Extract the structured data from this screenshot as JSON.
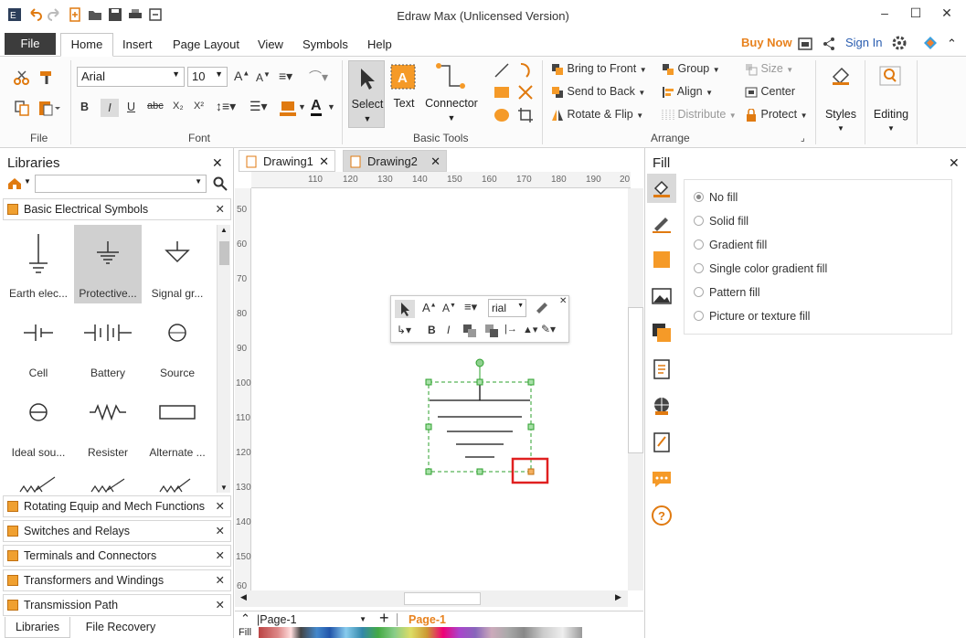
{
  "window": {
    "title": "Edraw Max (Unlicensed Version)"
  },
  "menu": {
    "file": "File",
    "items": [
      "Home",
      "Insert",
      "Page Layout",
      "View",
      "Symbols",
      "Help"
    ],
    "buy_now": "Buy Now",
    "sign_in": "Sign In"
  },
  "ribbon": {
    "file_group": "File",
    "font_group": "Font",
    "font_name": "Arial",
    "font_size": "10",
    "basic_tools_group": "Basic Tools",
    "select": "Select",
    "text": "Text",
    "connector": "Connector",
    "arrange_group": "Arrange",
    "bring_to_front": "Bring to Front",
    "send_to_back": "Send to Back",
    "rotate_flip": "Rotate & Flip",
    "group": "Group",
    "align": "Align",
    "distribute": "Distribute",
    "size": "Size",
    "center": "Center",
    "protect": "Protect",
    "styles": "Styles",
    "editing": "Editing"
  },
  "libraries": {
    "title": "Libraries",
    "active_section": "Basic Electrical Symbols",
    "shapes": [
      {
        "label": "Earth elec...",
        "icon": "earth-ground-icon"
      },
      {
        "label": "Protective...",
        "icon": "protective-ground-icon"
      },
      {
        "label": "Signal gr...",
        "icon": "signal-ground-icon"
      },
      {
        "label": "Cell",
        "icon": "cell-icon"
      },
      {
        "label": "Battery",
        "icon": "battery-icon"
      },
      {
        "label": "Source",
        "icon": "source-icon"
      },
      {
        "label": "Ideal sou...",
        "icon": "ideal-source-icon"
      },
      {
        "label": "Resister",
        "icon": "resistor-icon"
      },
      {
        "label": "Alternate ...",
        "icon": "alternate-resistor-icon"
      }
    ],
    "sections": [
      "Rotating Equip and Mech Functions",
      "Switches and Relays",
      "Terminals and Connectors",
      "Transformers and Windings",
      "Transmission Path"
    ],
    "bottom_tabs": [
      "Libraries",
      "File Recovery"
    ]
  },
  "documents": {
    "tabs": [
      "Drawing1",
      "Drawing2"
    ]
  },
  "ruler": {
    "h": [
      "110",
      "120",
      "130",
      "140",
      "150",
      "160",
      "170",
      "180",
      "190",
      "20"
    ],
    "v": [
      "50",
      "60",
      "70",
      "80",
      "90",
      "100",
      "110",
      "120",
      "130",
      "140",
      "150",
      "60"
    ]
  },
  "floating_toolbar": {
    "font": "rial"
  },
  "fill": {
    "title": "Fill",
    "options": [
      "No fill",
      "Solid fill",
      "Gradient fill",
      "Single color gradient fill",
      "Pattern fill",
      "Picture or texture fill"
    ],
    "selected": "No fill"
  },
  "status": {
    "page_selector": "Page-1",
    "page_tab": "Page-1",
    "fill_label": "Fill"
  },
  "colors": {
    "accent": "#e8821e",
    "orange": "#f59a28",
    "selection": "#2ca02c",
    "highlight_box": "#e02020"
  }
}
